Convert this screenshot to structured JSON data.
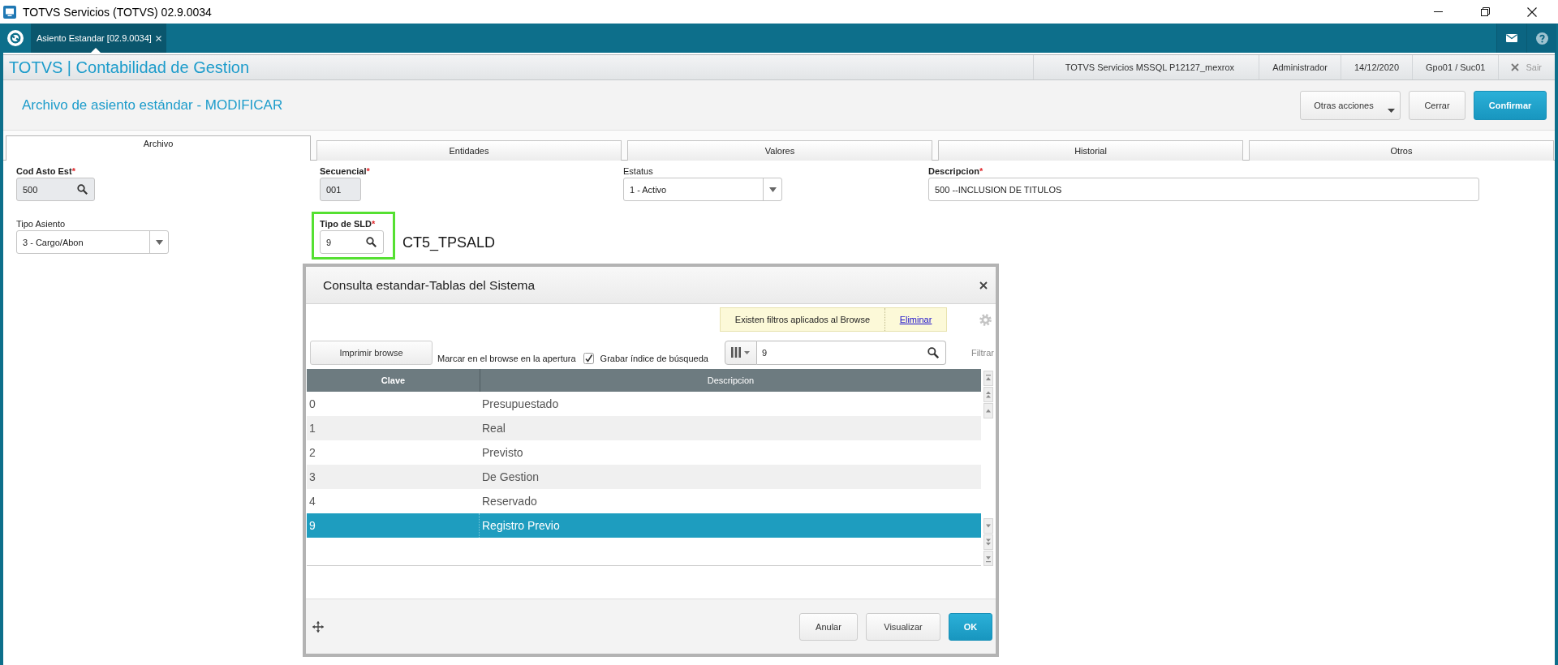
{
  "window": {
    "title": "TOTVS Servicios (TOTVS) 02.9.0034"
  },
  "app_tabs": [
    {
      "label": "Asiento Estandar [02.9.0034]",
      "selected": true
    }
  ],
  "header": {
    "title": "TOTVS | Contabilidad de Gestion",
    "info": [
      "TOTVS Servicios MSSQL P12127_mexrox",
      "Administrador",
      "14/12/2020",
      "Gpo01 / Suc01"
    ],
    "exit_label": "Sair"
  },
  "page": {
    "title": "Archivo de asiento estándar - MODIFICAR",
    "buttons": [
      {
        "label": "Otras acciones",
        "kind": "menu"
      },
      {
        "label": "Cerrar",
        "kind": "default"
      },
      {
        "label": "Confirmar",
        "kind": "primary"
      }
    ]
  },
  "form_tabs": [
    {
      "label": "Archivo",
      "selected": true
    },
    {
      "label": "Entidades",
      "selected": false
    },
    {
      "label": "Valores",
      "selected": false
    },
    {
      "label": "Historial",
      "selected": false
    },
    {
      "label": "Otros",
      "selected": false
    }
  ],
  "form": {
    "rows": [
      {
        "fields": [
          {
            "label": "Cod Asto Est",
            "mark": "*",
            "required": true,
            "kind": "lookup",
            "value": "500",
            "disabled": true,
            "highlighted": false
          },
          {
            "label": "Secuencial",
            "mark": "*",
            "required": true,
            "kind": "text",
            "value": "001",
            "disabled": true,
            "highlighted": false
          },
          {
            "label": "Estatus",
            "required": false,
            "kind": "select",
            "value": "1 - Activo",
            "disabled": false,
            "highlighted": false
          },
          {
            "label": "Descripcion",
            "mark": "*",
            "required": true,
            "kind": "text",
            "value": "500 --INCLUSION DE TITULOS",
            "disabled": false,
            "highlighted": false
          }
        ]
      },
      {
        "fields": [
          {
            "label": "Tipo Asiento",
            "required": false,
            "kind": "select",
            "value": "3 - Cargo/Abon",
            "disabled": false,
            "highlighted": false
          },
          {
            "label": "Tipo de SLD",
            "mark": "*",
            "required": true,
            "kind": "lookup",
            "value": "9",
            "disabled": false,
            "highlighted": true,
            "annotation": "CT5_TPSALD"
          }
        ]
      }
    ]
  },
  "dialog": {
    "title": "Consulta estandar-Tablas del Sistema",
    "notice": {
      "text": "Existen filtros aplicados al Browse",
      "link": "Eliminar"
    },
    "print_button": "Imprimir browse",
    "mark_label": "Marcar en el browse en la apertura",
    "checkbox": {
      "label": "Grabar índice de búsqueda",
      "checked": true
    },
    "search": {
      "value": "9"
    },
    "filter_button": "Filtrar",
    "table": {
      "columns": [
        {
          "label": "Clave",
          "sorted": true
        },
        {
          "label": "Descripcion",
          "sorted": false
        }
      ],
      "rows": [
        {
          "cells": [
            "0",
            "Presupuestado"
          ],
          "selected": false
        },
        {
          "cells": [
            "1",
            "Real"
          ],
          "selected": false
        },
        {
          "cells": [
            "2",
            "Previsto"
          ],
          "selected": false
        },
        {
          "cells": [
            "3",
            "De Gestion"
          ],
          "selected": false
        },
        {
          "cells": [
            "4",
            "Reservado"
          ],
          "selected": false
        },
        {
          "cells": [
            "9",
            "Registro Previo"
          ],
          "selected": true
        }
      ]
    },
    "buttons": [
      {
        "label": "Anular",
        "kind": "default"
      },
      {
        "label": "Visualizar",
        "kind": "default"
      },
      {
        "label": "OK",
        "kind": "primary"
      }
    ]
  }
}
